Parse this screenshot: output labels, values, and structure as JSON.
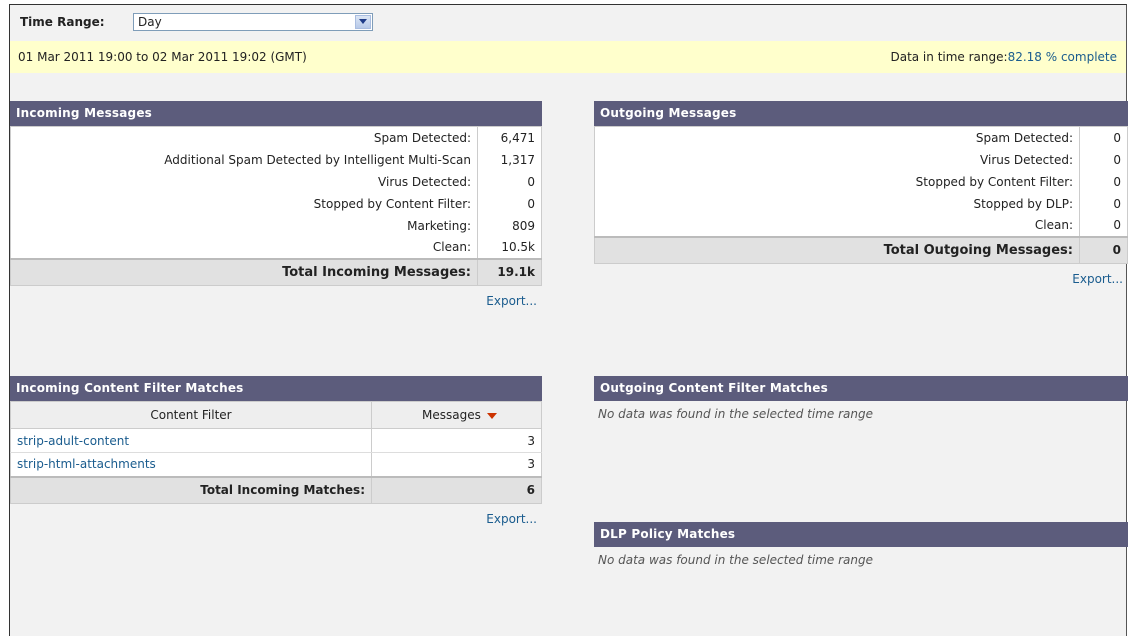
{
  "time_range": {
    "label": "Time Range:",
    "selected": "Day",
    "range_text": "01 Mar 2011 19:00 to 02 Mar 2011 19:02 (GMT)",
    "completeness_label": "Data in time range:",
    "completeness_value": "82.18 % complete"
  },
  "incoming_messages": {
    "title": "Incoming Messages",
    "rows": [
      {
        "label": "Spam Detected:",
        "value": "6,471"
      },
      {
        "label": "Additional Spam Detected by Intelligent Multi-Scan",
        "value": "1,317"
      },
      {
        "label": "Virus Detected:",
        "value": "0"
      },
      {
        "label": "Stopped by Content Filter:",
        "value": "0"
      },
      {
        "label": "Marketing:",
        "value": "809"
      },
      {
        "label": "Clean:",
        "value": "10.5k"
      }
    ],
    "total_label": "Total Incoming Messages:",
    "total_value": "19.1k",
    "export": "Export..."
  },
  "outgoing_messages": {
    "title": "Outgoing Messages",
    "rows": [
      {
        "label": "Spam Detected:",
        "value": "0"
      },
      {
        "label": "Virus Detected:",
        "value": "0"
      },
      {
        "label": "Stopped by Content Filter:",
        "value": "0"
      },
      {
        "label": "Stopped by DLP:",
        "value": "0"
      },
      {
        "label": "Clean:",
        "value": "0"
      }
    ],
    "total_label": "Total Outgoing Messages:",
    "total_value": "0",
    "export": "Export..."
  },
  "incoming_cf": {
    "title": "Incoming Content Filter Matches",
    "col_filter": "Content Filter",
    "col_messages": "Messages",
    "rows": [
      {
        "name": "strip-adult-content",
        "count": "3"
      },
      {
        "name": "strip-html-attachments",
        "count": "3"
      }
    ],
    "total_label": "Total Incoming Matches:",
    "total_value": "6",
    "export": "Export..."
  },
  "outgoing_cf": {
    "title": "Outgoing Content Filter Matches",
    "empty": "No data was found in the selected time range"
  },
  "dlp": {
    "title": "DLP Policy Matches",
    "empty": "No data was found in the selected time range"
  },
  "colors": {
    "panel_header": "#5c5c7c",
    "date_bar": "#ffffcc",
    "link": "#1a5c8e",
    "sort_arrow": "#cc3300"
  }
}
